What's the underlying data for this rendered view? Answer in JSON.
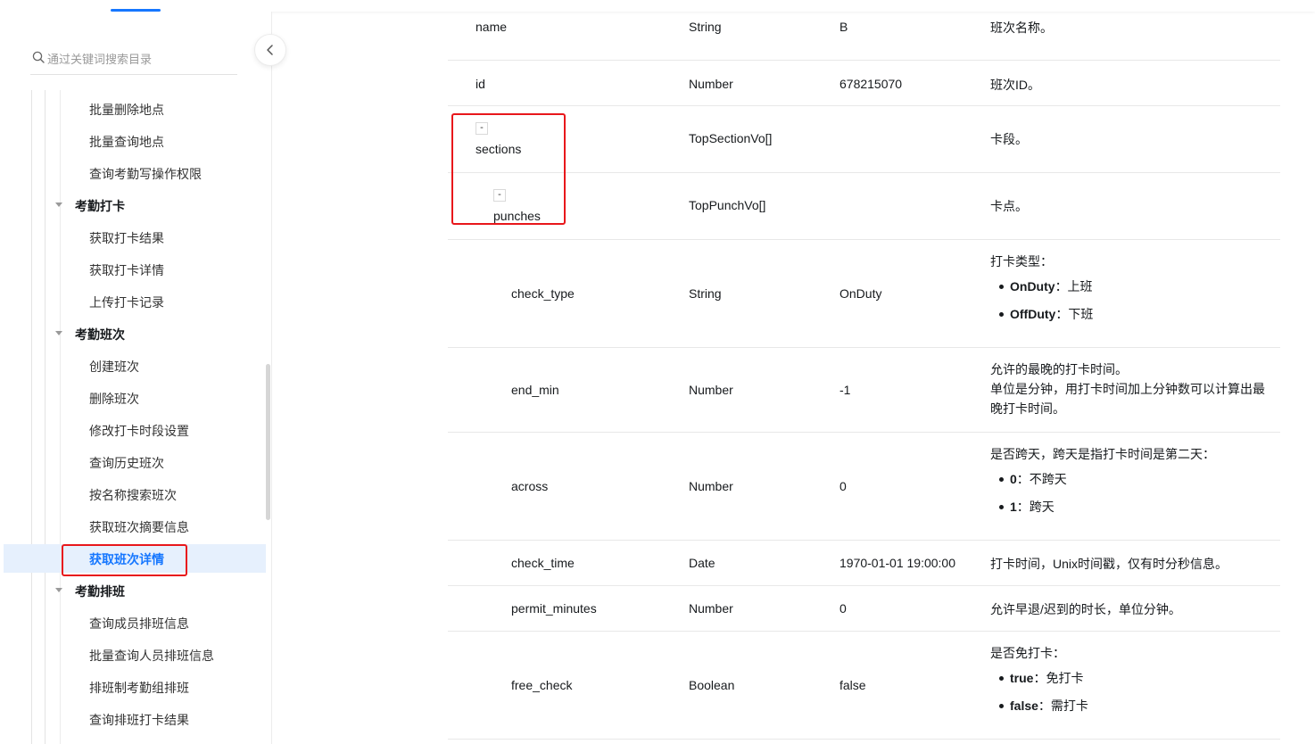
{
  "search": {
    "placeholder": "通过关键词搜索目录"
  },
  "sidebar": {
    "items": [
      {
        "label": "批量删除地点",
        "kind": "item"
      },
      {
        "label": "批量查询地点",
        "kind": "item"
      },
      {
        "label": "查询考勤写操作权限",
        "kind": "item"
      },
      {
        "label": "考勤打卡",
        "kind": "group"
      },
      {
        "label": "获取打卡结果",
        "kind": "item"
      },
      {
        "label": "获取打卡详情",
        "kind": "item"
      },
      {
        "label": "上传打卡记录",
        "kind": "item"
      },
      {
        "label": "考勤班次",
        "kind": "group"
      },
      {
        "label": "创建班次",
        "kind": "item"
      },
      {
        "label": "删除班次",
        "kind": "item"
      },
      {
        "label": "修改打卡时段设置",
        "kind": "item"
      },
      {
        "label": "查询历史班次",
        "kind": "item"
      },
      {
        "label": "按名称搜索班次",
        "kind": "item"
      },
      {
        "label": "获取班次摘要信息",
        "kind": "item"
      },
      {
        "label": "获取班次详情",
        "kind": "item",
        "active": true
      },
      {
        "label": "考勤排班",
        "kind": "group"
      },
      {
        "label": "查询成员排班信息",
        "kind": "item"
      },
      {
        "label": "批量查询人员排班信息",
        "kind": "item"
      },
      {
        "label": "排班制考勤组排班",
        "kind": "item"
      },
      {
        "label": "查询排班打卡结果",
        "kind": "item"
      }
    ]
  },
  "table": {
    "rows": [
      {
        "name": "name",
        "type": "String",
        "example": "B",
        "desc": "班次名称。"
      },
      {
        "name": "id",
        "type": "Number",
        "example": "678215070",
        "desc": "班次ID。"
      },
      {
        "name": "sections",
        "type": "TopSectionVo[]",
        "example": "",
        "desc": "卡段。",
        "toggle": "-"
      },
      {
        "name": "punches",
        "type": "TopPunchVo[]",
        "example": "",
        "desc": "卡点。",
        "toggle": "-"
      },
      {
        "name": "check_type",
        "type": "String",
        "example": "OnDuty",
        "desc": "打卡类型：",
        "bullets": [
          {
            "key": "OnDuty",
            "text": "：上班"
          },
          {
            "key": "OffDuty",
            "text": "：下班"
          }
        ]
      },
      {
        "name": "end_min",
        "type": "Number",
        "example": "-1",
        "desc_lines": [
          "允许的最晚的打卡时间。",
          "单位是分钟，用打卡时间加上分钟数可以计算出最晚打卡时间。"
        ]
      },
      {
        "name": "across",
        "type": "Number",
        "example": "0",
        "desc": "是否跨天，跨天是指打卡时间是第二天：",
        "bullets": [
          {
            "key": "0",
            "text": "：不跨天"
          },
          {
            "key": "1",
            "text": "：跨天"
          }
        ]
      },
      {
        "name": "check_time",
        "type": "Date",
        "example": "1970-01-01 19:00:00",
        "desc": "打卡时间，Unix时间戳，仅有时分秒信息。"
      },
      {
        "name": "permit_minutes",
        "type": "Number",
        "example": "0",
        "desc": "允许早退/迟到的时长，单位分钟。"
      },
      {
        "name": "free_check",
        "type": "Boolean",
        "example": "false",
        "desc": "是否免打卡：",
        "bullets": [
          {
            "key": "true",
            "text": "：免打卡"
          },
          {
            "key": "false",
            "text": "：需打卡"
          }
        ]
      }
    ]
  },
  "colors": {
    "accent": "#1677ff",
    "highlight": "#e8171b",
    "active_bg": "#e6f0fd"
  }
}
